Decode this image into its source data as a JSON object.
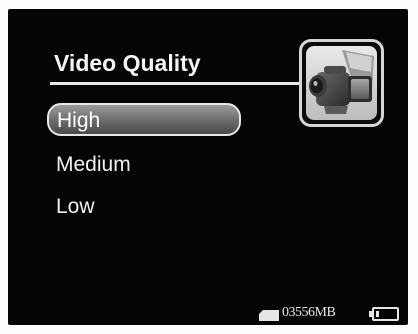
{
  "screen": {
    "title": "Video Quality",
    "menu": {
      "items": [
        {
          "label": "High",
          "selected": true
        },
        {
          "label": "Medium",
          "selected": false
        },
        {
          "label": "Low",
          "selected": false
        }
      ]
    },
    "mode_icon": "video-camera-icon",
    "status": {
      "storage_icon": "sd-card-icon",
      "storage_remaining": "03556MB",
      "battery_icon": "battery-icon"
    }
  },
  "colors": {
    "screen_background": "#050505",
    "text": "#f0f0f0",
    "selection_fill": "#7a7a7a",
    "selection_border": "#e6e6e6"
  }
}
